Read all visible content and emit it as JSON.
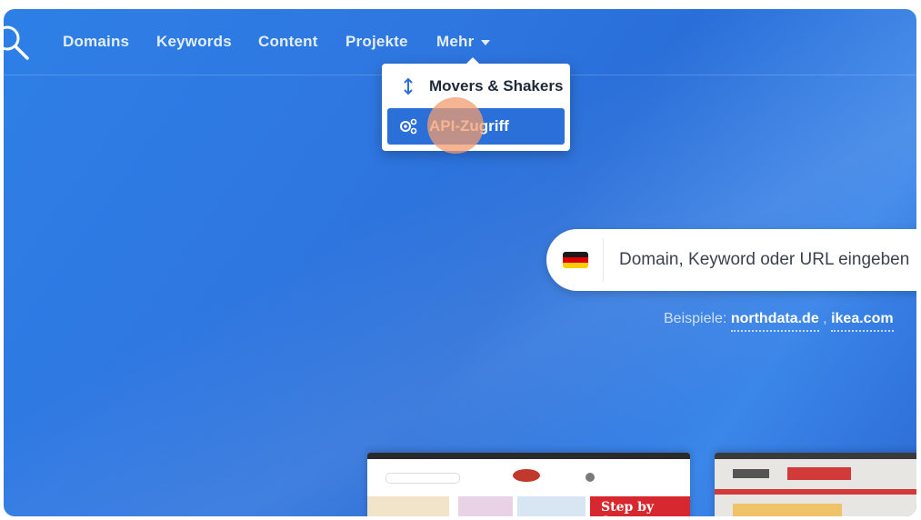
{
  "nav": {
    "items": [
      "Domains",
      "Keywords",
      "Content",
      "Projekte"
    ],
    "more_label": "Mehr"
  },
  "dropdown": {
    "items": [
      {
        "label": "Movers & Shakers",
        "icon": "up-down-arrow-icon"
      },
      {
        "label": "API-Zugriff",
        "icon": "api-gears-icon",
        "active": true
      }
    ]
  },
  "search": {
    "placeholder": "Domain, Keyword oder URL eingeben",
    "country_flag": "de-flag-icon"
  },
  "examples": {
    "prefix": "Beispiele:",
    "items": [
      "northdata.de",
      "ikea.com"
    ],
    "separator": ","
  },
  "thumbnails": {
    "first_banner": "Step by Step"
  },
  "colors": {
    "background": "#2d7fe6",
    "active_item": "#2b6fd8",
    "cursor_highlight": "#f39c6e"
  }
}
